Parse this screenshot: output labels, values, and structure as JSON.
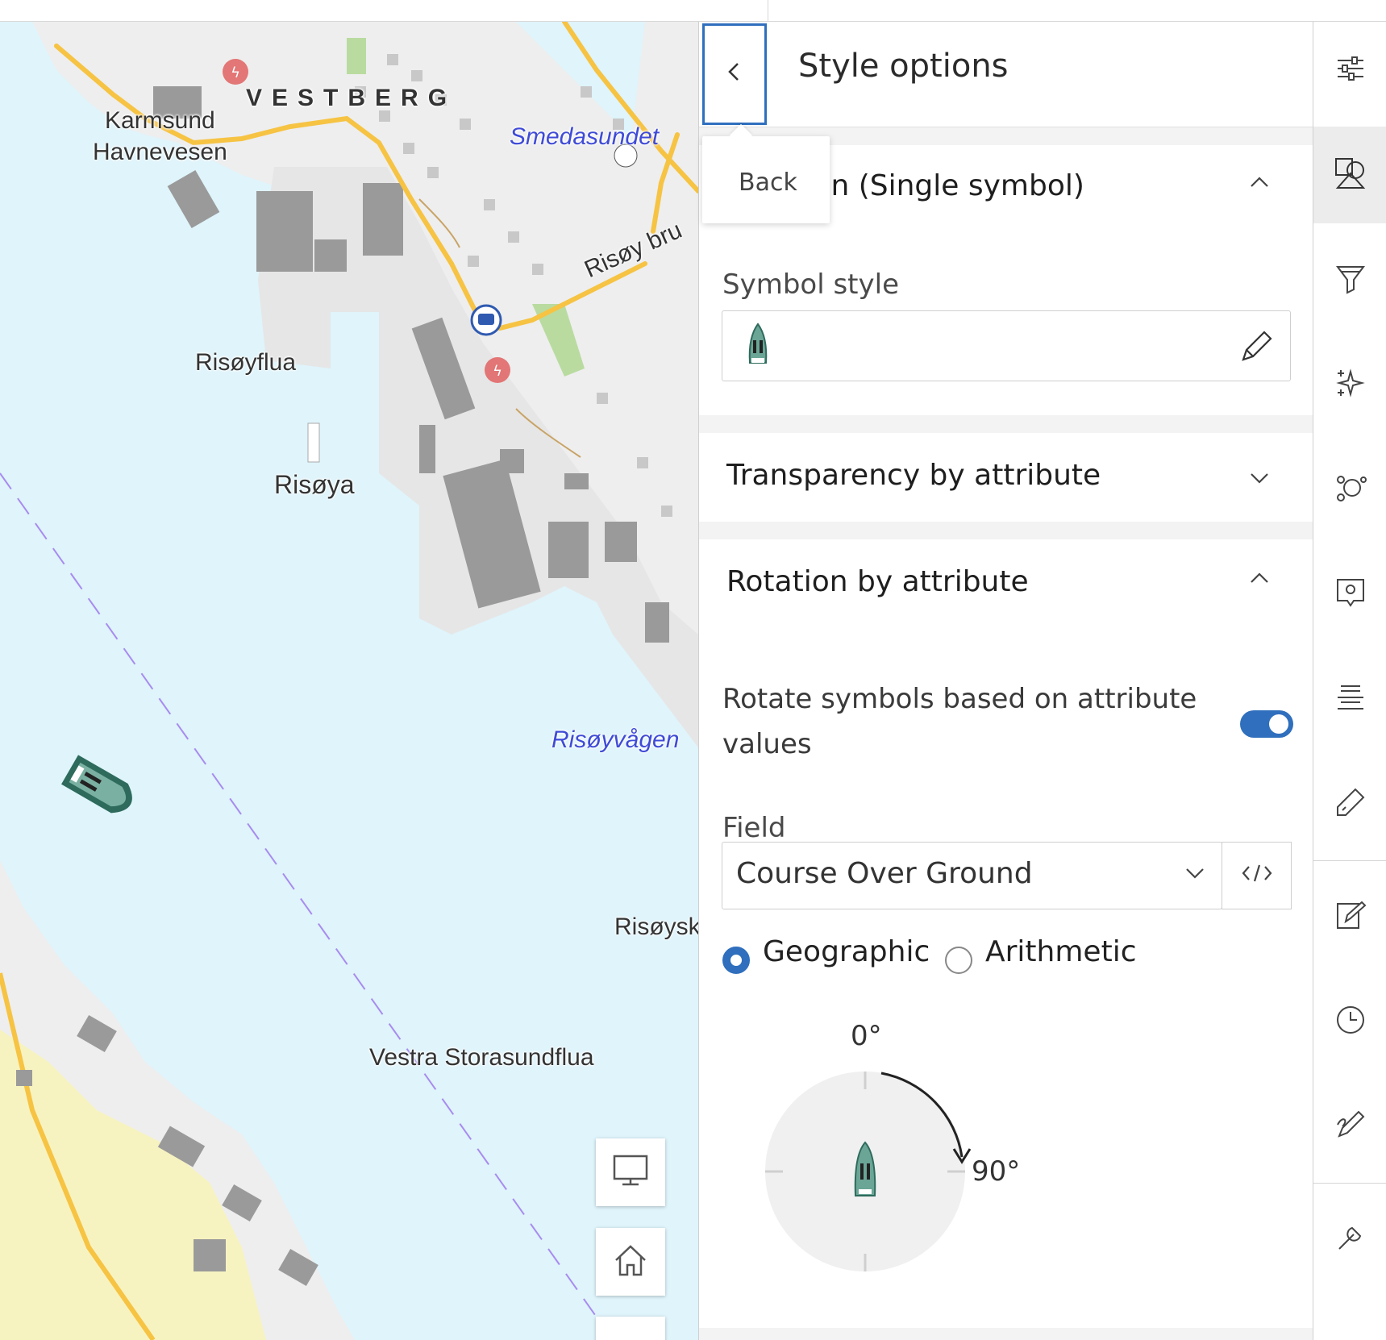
{
  "map": {
    "labels": {
      "vestberg": "VESTBERG",
      "karmsund": "Karmsund",
      "havnevesen": "Havnevesen",
      "smedasundet": "Smedasundet",
      "risoy_bru": "Risøy bru",
      "risoyflua": "Risøyflua",
      "risoya": "Risøya",
      "risoyvagen": "Risøyvågen",
      "risoysk": "Risøysk",
      "vestra_storasundflua": "Vestra Storasundflua"
    },
    "controls": {
      "display_icon": "monitor-icon",
      "home_icon": "home-icon"
    }
  },
  "panel": {
    "title": "Style options",
    "back_tooltip": "Back",
    "sections": {
      "location": {
        "title": "Location (Single symbol)",
        "expanded": true
      },
      "transparency": {
        "title": "Transparency by attribute",
        "expanded": false
      },
      "rotation": {
        "title": "Rotation by attribute",
        "expanded": true
      }
    },
    "symbol_style_label": "Symbol style",
    "rotate_toggle_label": "Rotate symbols based on attribute values",
    "rotate_toggle_on": true,
    "field_label": "Field",
    "field_value": "Course Over Ground",
    "rotation_types": [
      "Geographic",
      "Arithmetic"
    ],
    "rotation_type_selected": "Geographic",
    "dial": {
      "top_label": "0°",
      "right_label": "90°"
    }
  },
  "rail": {
    "icons": [
      "properties-icon",
      "styles-icon",
      "filter-icon",
      "effects-icon",
      "clustering-icon",
      "popups-icon",
      "labels-icon",
      "fields-icon",
      "edit-icon",
      "time-icon",
      "sketch-icon",
      "configure-icon"
    ],
    "active": "styles-icon"
  },
  "colors": {
    "accent": "#2f6fbd",
    "water": "#dff4fb",
    "land": "#eeeeee",
    "road": "#f6c343"
  }
}
